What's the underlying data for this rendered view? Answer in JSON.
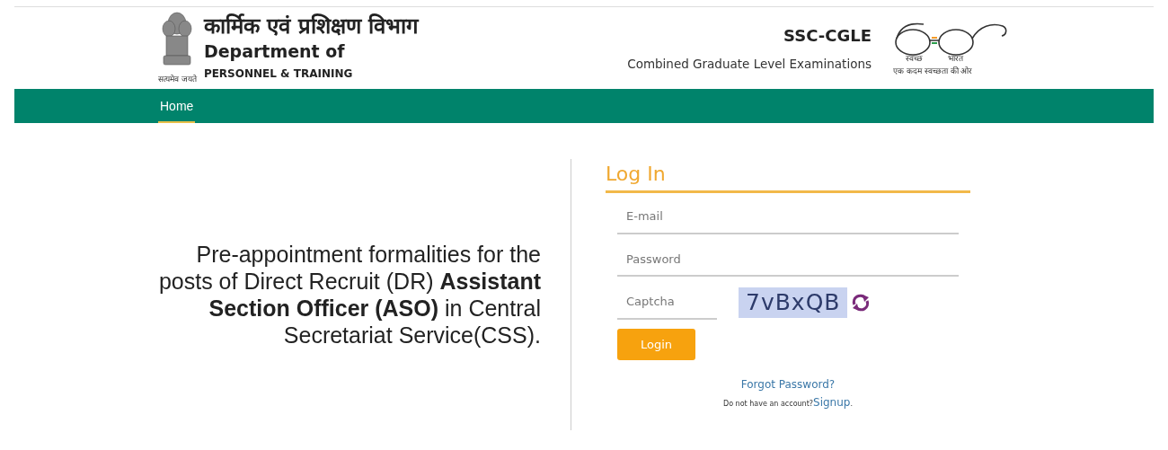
{
  "header": {
    "emblem_motto": "सत्यमेव जयते",
    "title_hindi": "कार्मिक एवं प्रशिक्षण विभाग",
    "title_line1": "Department of",
    "title_line2": "PERSONNEL & TRAINING",
    "exam_code": "SSC-CGLE",
    "exam_name": "Combined Graduate Level Examinations",
    "swachh_left": "स्वच्छ",
    "swachh_right": "भारत",
    "swachh_tagline": "एक कदम स्वच्छता की ओर"
  },
  "nav": [
    {
      "label": "Home",
      "selected": true
    }
  ],
  "intro": "Pre-appointment formalities for the posts of Direct Recruit (DR) **Assistant Section Officer (ASO)** in Central Secretariat Service(CSS).",
  "login": {
    "title": "Log In",
    "fields": [
      {
        "placeholder": "E-mail",
        "kind": "email"
      },
      {
        "placeholder": "Password",
        "kind": "password"
      },
      {
        "placeholder": "Captcha",
        "kind": "captcha"
      }
    ],
    "captcha_text": "7vBxQB",
    "button": "Login",
    "forgot": "Forgot Password?",
    "signup_prompt": "Do not have an account?",
    "signup_link": "Signup",
    "signup_end": "."
  }
}
